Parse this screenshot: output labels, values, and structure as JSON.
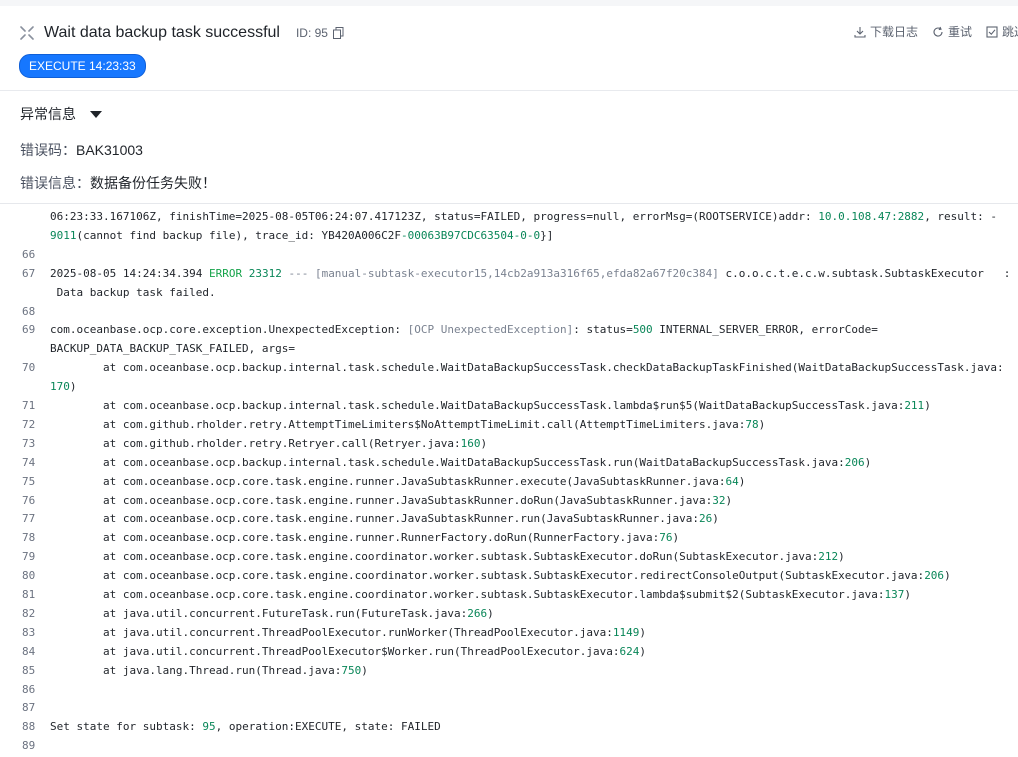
{
  "header": {
    "title": "Wait data backup task successful",
    "id_label": "ID: 95",
    "badge": "EXECUTE 14:23:33",
    "actions": {
      "download": "下载日志",
      "retry": "重试",
      "skip": "跳过"
    }
  },
  "exception": {
    "title": "异常信息",
    "code_label": "错误码：",
    "code": "BAK31003",
    "msg_label": "错误信息：",
    "msg": "数据备份任务失败！"
  },
  "log": {
    "lines": [
      {
        "n": "",
        "text": "06:23:33.167106Z, finishTime=2025-08-05T06:24:07.417123Z, status=FAILED, progress=null, errorMsg=(ROOTSERVICE)addr: 10.0.108.47:2882, result: -"
      },
      {
        "n": "",
        "text": "9011(cannot find backup file), trace_id: YB420A006C2F-00063B97CDC63504-0-0}]"
      },
      {
        "n": "66",
        "text": ""
      },
      {
        "n": "67",
        "text": "2025-08-05 14:24:34.394 ERROR 23312 --- [manual-subtask-executor15,14cb2a913a316f65,efda82a67f20c384] c.o.o.c.t.e.c.w.subtask.SubtaskExecutor   :"
      },
      {
        "n": "",
        "text": " Data backup task failed."
      },
      {
        "n": "68",
        "text": ""
      },
      {
        "n": "69",
        "text": "com.oceanbase.ocp.core.exception.UnexpectedException: [OCP UnexpectedException]: status=500 INTERNAL_SERVER_ERROR, errorCode="
      },
      {
        "n": "",
        "text": "BACKUP_DATA_BACKUP_TASK_FAILED, args="
      },
      {
        "n": "70",
        "text": "        at com.oceanbase.ocp.backup.internal.task.schedule.WaitDataBackupSuccessTask.checkDataBackupTaskFinished(WaitDataBackupSuccessTask.java:"
      },
      {
        "n": "",
        "text": "170)"
      },
      {
        "n": "71",
        "text": "        at com.oceanbase.ocp.backup.internal.task.schedule.WaitDataBackupSuccessTask.lambda$run$5(WaitDataBackupSuccessTask.java:211)"
      },
      {
        "n": "72",
        "text": "        at com.github.rholder.retry.AttemptTimeLimiters$NoAttemptTimeLimit.call(AttemptTimeLimiters.java:78)"
      },
      {
        "n": "73",
        "text": "        at com.github.rholder.retry.Retryer.call(Retryer.java:160)"
      },
      {
        "n": "74",
        "text": "        at com.oceanbase.ocp.backup.internal.task.schedule.WaitDataBackupSuccessTask.run(WaitDataBackupSuccessTask.java:206)"
      },
      {
        "n": "75",
        "text": "        at com.oceanbase.ocp.core.task.engine.runner.JavaSubtaskRunner.execute(JavaSubtaskRunner.java:64)"
      },
      {
        "n": "76",
        "text": "        at com.oceanbase.ocp.core.task.engine.runner.JavaSubtaskRunner.doRun(JavaSubtaskRunner.java:32)"
      },
      {
        "n": "77",
        "text": "        at com.oceanbase.ocp.core.task.engine.runner.JavaSubtaskRunner.run(JavaSubtaskRunner.java:26)"
      },
      {
        "n": "78",
        "text": "        at com.oceanbase.ocp.core.task.engine.runner.RunnerFactory.doRun(RunnerFactory.java:76)"
      },
      {
        "n": "79",
        "text": "        at com.oceanbase.ocp.core.task.engine.coordinator.worker.subtask.SubtaskExecutor.doRun(SubtaskExecutor.java:212)"
      },
      {
        "n": "80",
        "text": "        at com.oceanbase.ocp.core.task.engine.coordinator.worker.subtask.SubtaskExecutor.redirectConsoleOutput(SubtaskExecutor.java:206)"
      },
      {
        "n": "81",
        "text": "        at com.oceanbase.ocp.core.task.engine.coordinator.worker.subtask.SubtaskExecutor.lambda$submit$2(SubtaskExecutor.java:137)"
      },
      {
        "n": "82",
        "text": "        at java.util.concurrent.FutureTask.run(FutureTask.java:266)"
      },
      {
        "n": "83",
        "text": "        at java.util.concurrent.ThreadPoolExecutor.runWorker(ThreadPoolExecutor.java:1149)"
      },
      {
        "n": "84",
        "text": "        at java.util.concurrent.ThreadPoolExecutor$Worker.run(ThreadPoolExecutor.java:624)"
      },
      {
        "n": "85",
        "text": "        at java.lang.Thread.run(Thread.java:750)"
      },
      {
        "n": "86",
        "text": ""
      },
      {
        "n": "87",
        "text": ""
      },
      {
        "n": "88",
        "text": "Set state for subtask: 95, operation:EXECUTE, state: FAILED"
      },
      {
        "n": "89",
        "text": ""
      }
    ]
  }
}
